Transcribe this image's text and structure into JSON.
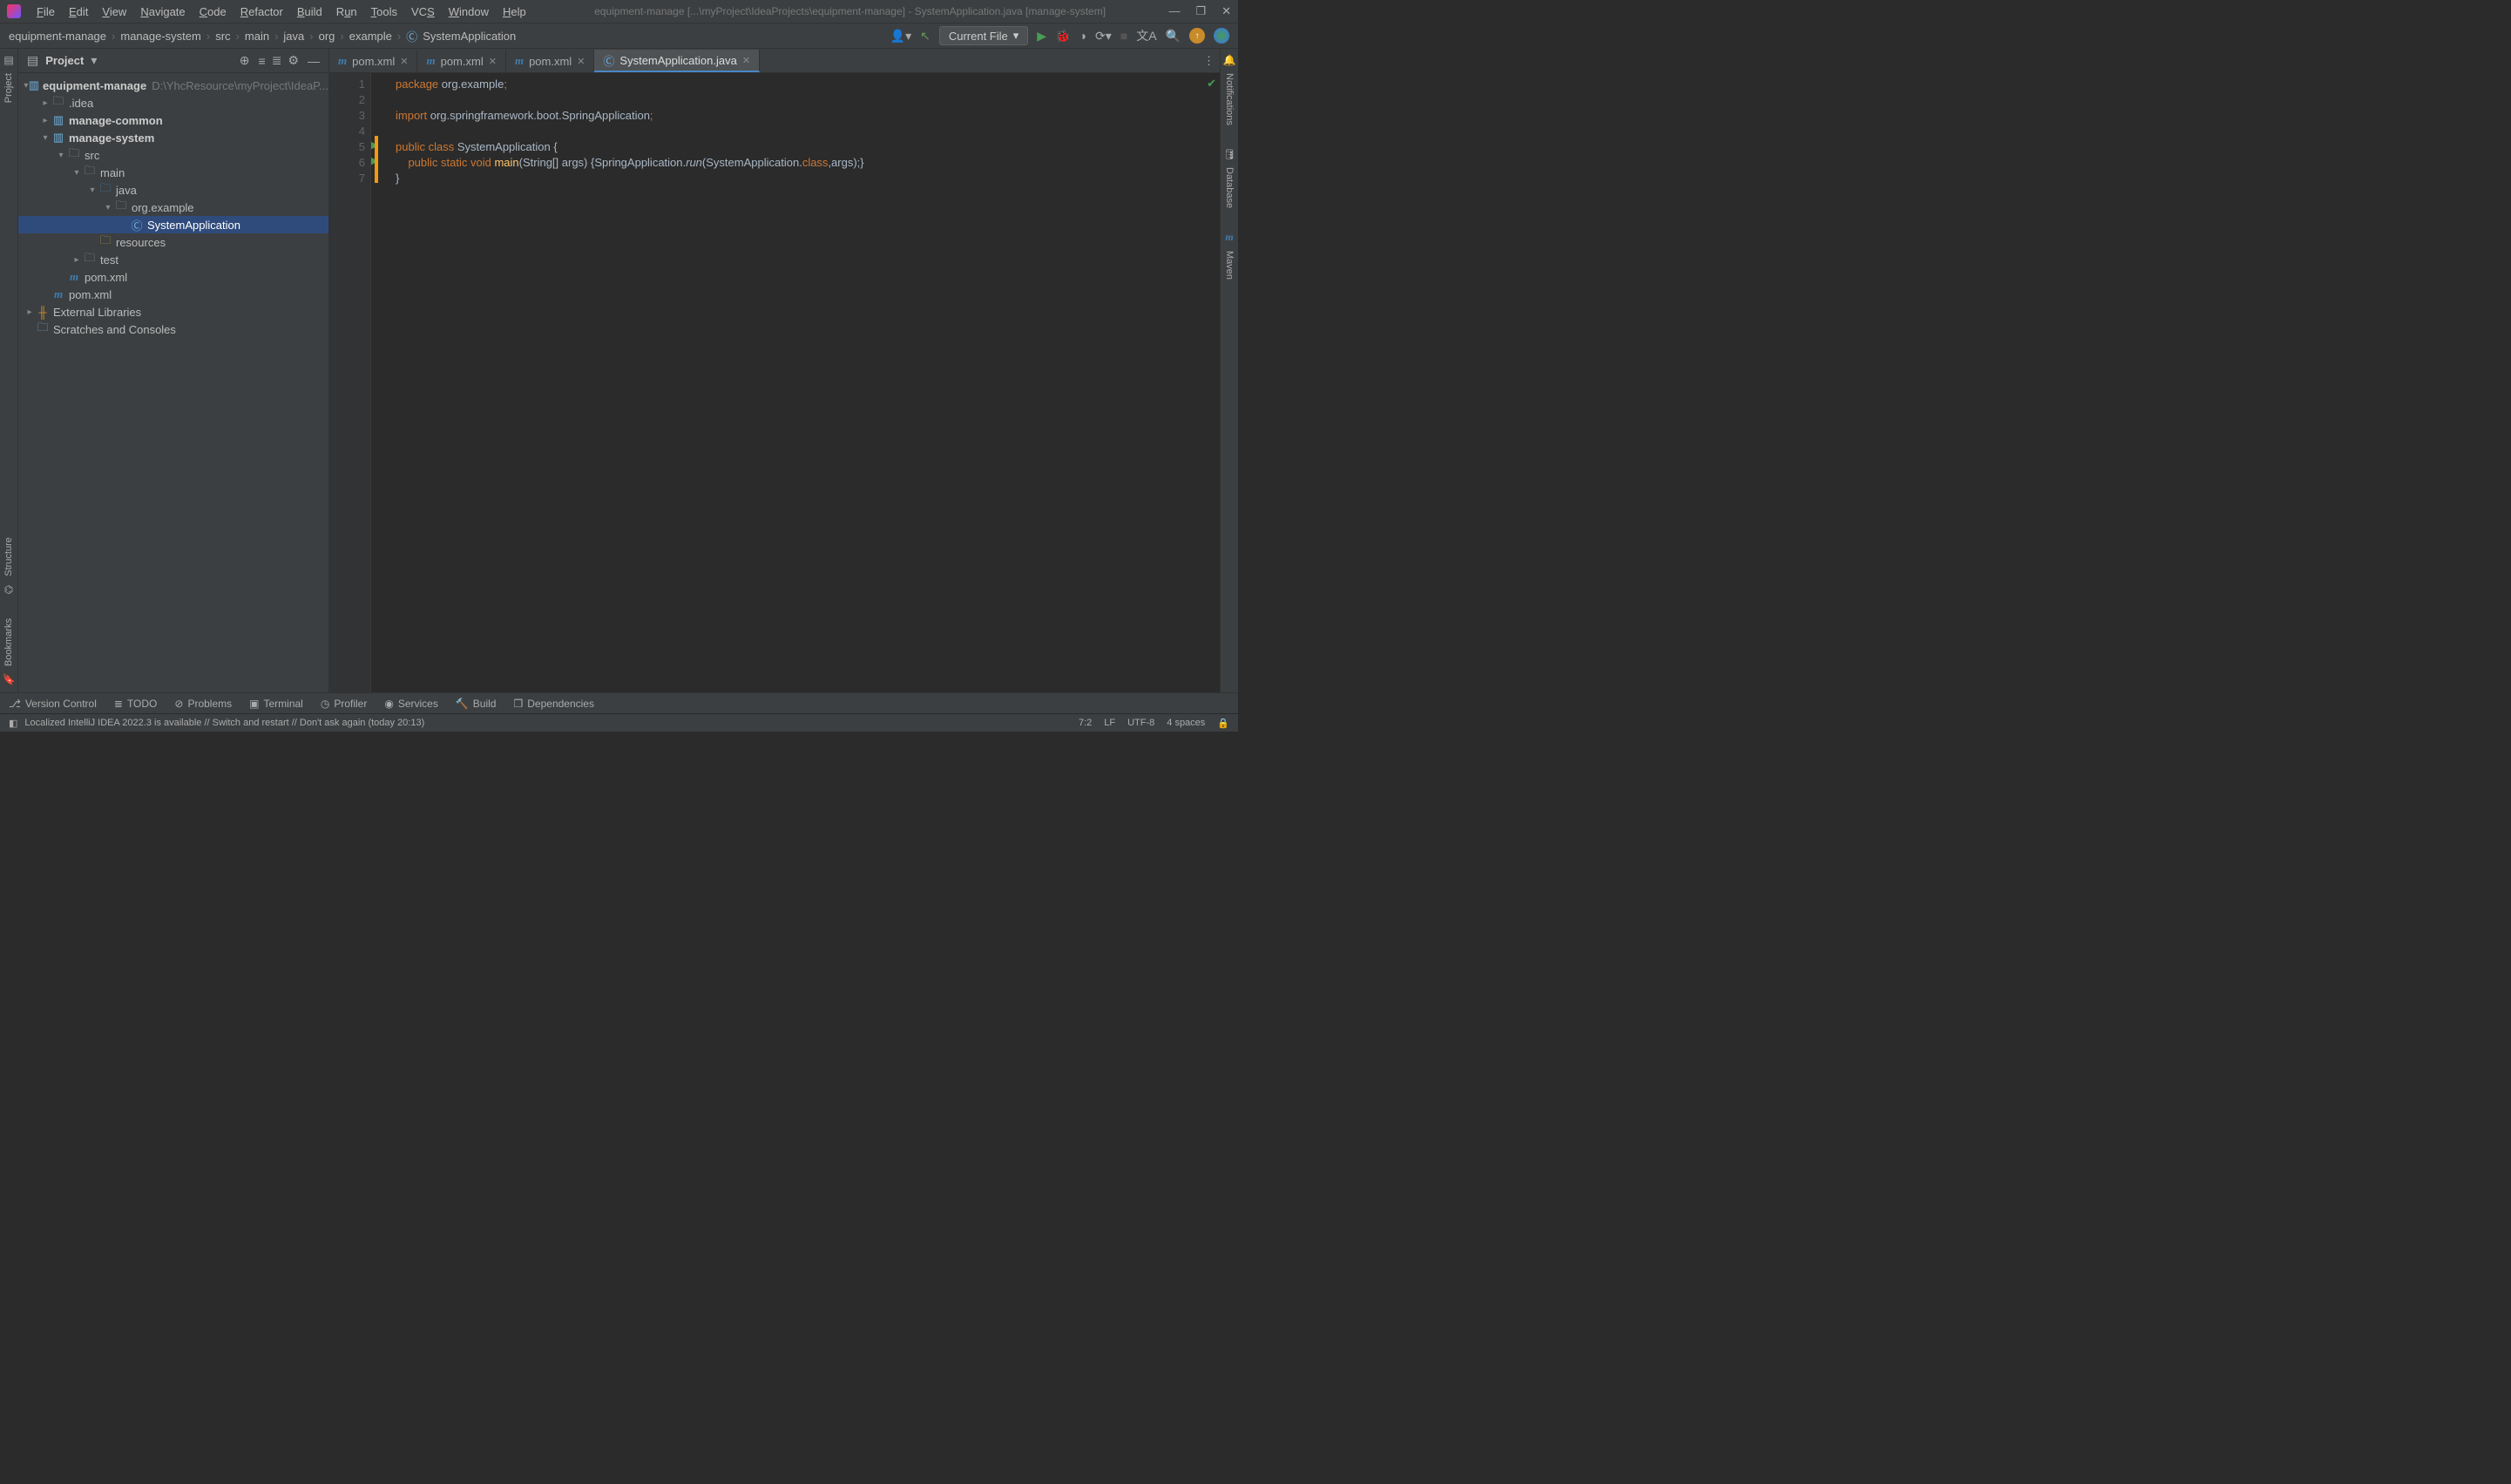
{
  "menu": [
    "File",
    "Edit",
    "View",
    "Navigate",
    "Code",
    "Refactor",
    "Build",
    "Run",
    "Tools",
    "VCS",
    "Window",
    "Help"
  ],
  "title": "equipment-manage [...\\myProject\\IdeaProjects\\equipment-manage] - SystemApplication.java [manage-system]",
  "crumbs": [
    "equipment-manage",
    "manage-system",
    "src",
    "main",
    "java",
    "org",
    "example",
    "SystemApplication"
  ],
  "runConfig": "Current File",
  "projectPane": {
    "title": "Project"
  },
  "tree": {
    "root": {
      "name": "equipment-manage",
      "path": "D:\\YhcResource\\myProject\\IdeaP..."
    },
    "idea": ".idea",
    "common": "manage-common",
    "system": "manage-system",
    "src": "src",
    "main": "main",
    "java": "java",
    "pkg": "org.example",
    "cls": "SystemApplication",
    "resources": "resources",
    "test": "test",
    "pom1": "pom.xml",
    "pom2": "pom.xml",
    "ext": "External Libraries",
    "scratch": "Scratches and Consoles"
  },
  "tabs": [
    {
      "label": "pom.xml",
      "type": "mvn"
    },
    {
      "label": "pom.xml",
      "type": "mvn"
    },
    {
      "label": "pom.xml",
      "type": "mvn"
    },
    {
      "label": "SystemApplication.java",
      "type": "class",
      "active": true
    }
  ],
  "code": {
    "lines": [
      1,
      2,
      3,
      4,
      5,
      6,
      7
    ],
    "l1": {
      "a": "package ",
      "b": "org.example",
      ";": ";"
    },
    "l3": {
      "a": "import ",
      "b": "org.springframework.boot.SpringApplication",
      ";": ";"
    },
    "l5": {
      "a": "public class ",
      "b": "SystemApplication ",
      "c": "{"
    },
    "l6": {
      "a": "    public static void ",
      "b": "main",
      "c": "(String[] args) {SpringApplication.",
      "d": "run",
      "e": "(SystemApplication.",
      "f": "class",
      "g": ",args);}"
    },
    "l7": "}"
  },
  "bottomTabs": [
    "Version Control",
    "TODO",
    "Problems",
    "Terminal",
    "Profiler",
    "Services",
    "Build",
    "Dependencies"
  ],
  "status": {
    "msg": "Localized IntelliJ IDEA 2022.3 is available // Switch and restart // Don't ask again (today 20:13)",
    "pos": "7:2",
    "sep": "LF",
    "enc": "UTF-8",
    "indent": "4 spaces"
  },
  "rightTabs": [
    "Notifications",
    "Database",
    "Maven"
  ]
}
